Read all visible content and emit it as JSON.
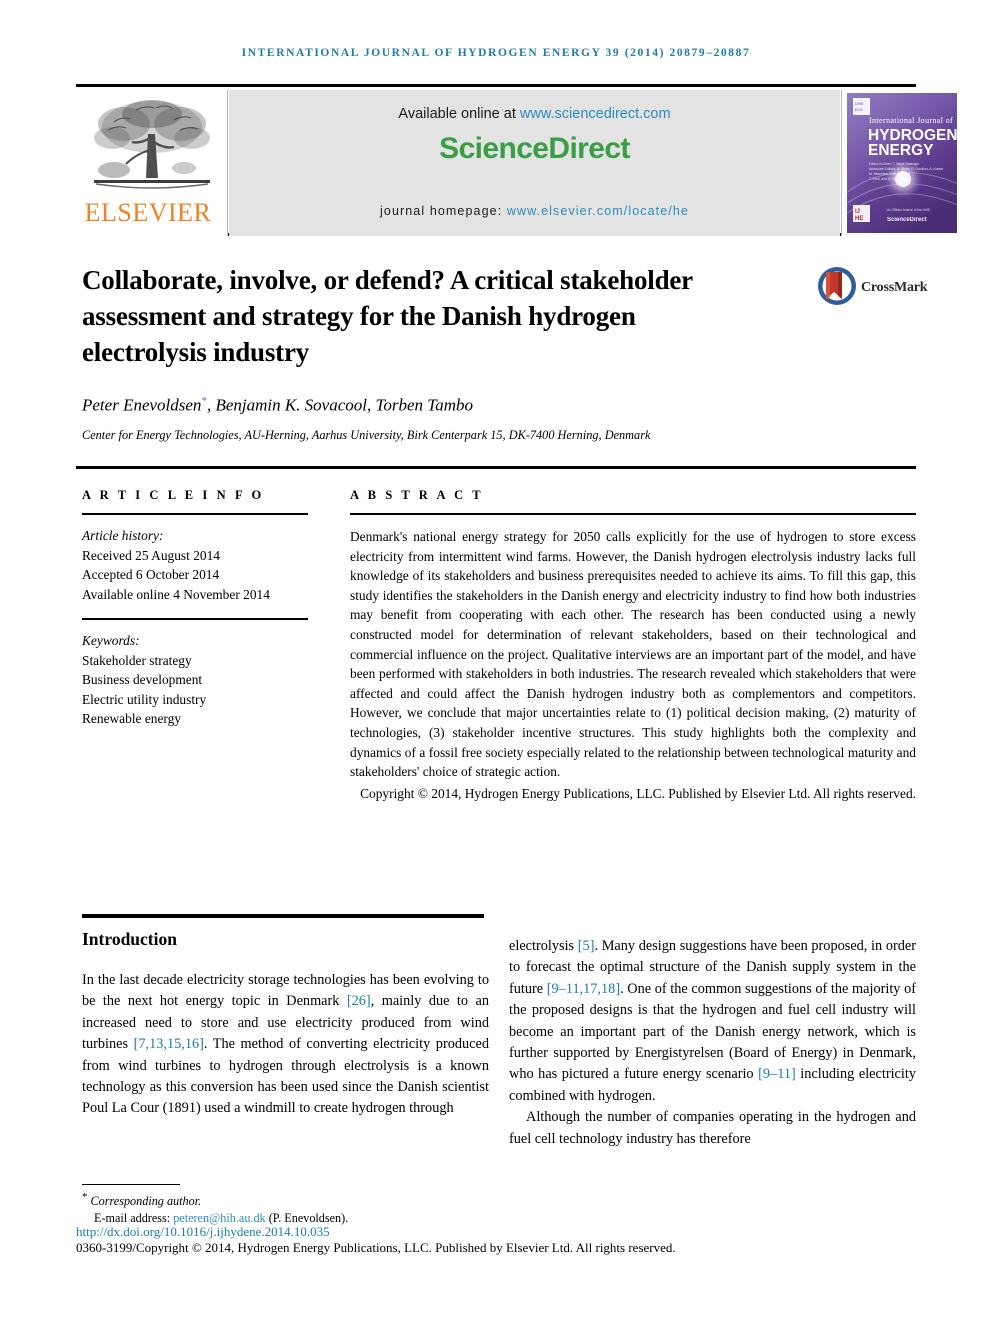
{
  "running_head": "International Journal of Hydrogen Energy 39 (2014) 20879–20887",
  "masthead": {
    "publisher_name": "ELSEVIER",
    "available_prefix": "Available online at ",
    "available_link": "www.sciencedirect.com",
    "sciencedirect_logo": "ScienceDirect",
    "homepage_prefix": "journal homepage: ",
    "homepage_link": "www.elsevier.com/locate/he",
    "cover": {
      "line1": "International Journal of",
      "line2": "HYDROGEN",
      "line3": "ENERGY",
      "footer_mark": "ScienceDirect"
    }
  },
  "article": {
    "title": "Collaborate, involve, or defend? A critical stakeholder assessment and strategy for the Danish hydrogen electrolysis industry",
    "authors": "Peter Enevoldsen",
    "authors_rest": ", Benjamin K. Sovacool, Torben Tambo",
    "corresponding_marker": "*",
    "affiliation": "Center for Energy Technologies, AU-Herning, Aarhus University, Birk Centerpark 15, DK-7400 Herning, Denmark",
    "crossmark_label": "CrossMark"
  },
  "info": {
    "heading": "A R T I C L E   I N F O",
    "history_label": "Article history:",
    "history": [
      "Received 25 August 2014",
      "Accepted 6 October 2014",
      "Available online 4 November 2014"
    ],
    "keywords_label": "Keywords:",
    "keywords": [
      "Stakeholder strategy",
      "Business development",
      "Electric utility industry",
      "Renewable energy"
    ]
  },
  "abstract": {
    "heading": "A B S T R A C T",
    "body": "Denmark's national energy strategy for 2050 calls explicitly for the use of hydrogen to store excess electricity from intermittent wind farms. However, the Danish hydrogen electrolysis industry lacks full knowledge of its stakeholders and business prerequisites needed to achieve its aims. To fill this gap, this study identifies the stakeholders in the Danish energy and electricity industry to find how both industries may benefit from cooperating with each other. The research has been conducted using a newly constructed model for determination of relevant stakeholders, based on their technological and commercial influence on the project. Qualitative interviews are an important part of the model, and have been performed with stakeholders in both industries. The research revealed which stakeholders that were affected and could affect the Danish hydrogen industry both as complementors and competitors. However, we conclude that major uncertainties relate to (1) political decision making, (2) maturity of technologies, (3) stakeholder incentive structures. This study highlights both the complexity and dynamics of a fossil free society especially related to the relationship between technological maturity and stakeholders' choice of strategic action.",
    "copyright": "Copyright © 2014, Hydrogen Energy Publications, LLC. Published by Elsevier Ltd. All rights reserved."
  },
  "body": {
    "section_title": "Introduction",
    "left_p1_a": "In the last decade electricity storage technologies has been evolving to be the next hot energy topic in Denmark ",
    "left_cite1": "[26]",
    "left_p1_b": ", mainly due to an increased need to store and use electricity produced from wind turbines ",
    "left_cite2": "[7,13,15,16]",
    "left_p1_c": ". The method of converting electricity produced from wind turbines to hydrogen through electrolysis is a known technology as this conversion has been used since the Danish scientist Poul La Cour (1891) used a windmill to create hydrogen through",
    "right_p1_a": "electrolysis ",
    "right_cite1": "[5]",
    "right_p1_b": ". Many design suggestions have been proposed, in order to forecast the optimal structure of the Danish supply system in the future ",
    "right_cite2": "[9–11,17,18]",
    "right_p1_c": ". One of the common suggestions of the majority of the proposed designs is that the hydrogen and fuel cell industry will become an important part of the Danish energy network, which is further supported by Energistyrelsen (Board of Energy) in Denmark, who has pictured a future energy scenario ",
    "right_cite3": "[9–11]",
    "right_p1_d": " including electricity combined with hydrogen.",
    "right_p2": "Although the number of companies operating in the hydrogen and fuel cell technology industry has therefore"
  },
  "footer": {
    "corresponding_star": "*",
    "corresponding_text": "Corresponding author.",
    "email_label": "E-mail address: ",
    "email": "peteren@hih.au.dk",
    "email_suffix": " (P. Enevoldsen).",
    "doi": "http://dx.doi.org/10.1016/j.ijhydene.2014.10.035",
    "issn_line": "0360-3199/Copyright © 2014, Hydrogen Energy Publications, LLC. Published by Elsevier Ltd. All rights reserved."
  },
  "colors": {
    "journal_blue": "#1f7ba8",
    "link_blue": "#2a8cbb",
    "citation_blue": "#1c7bb5",
    "sciencedirect_green": "#3a9e45",
    "elsevier_orange": "#f08122",
    "banner_gray": "#e3e3e3"
  }
}
